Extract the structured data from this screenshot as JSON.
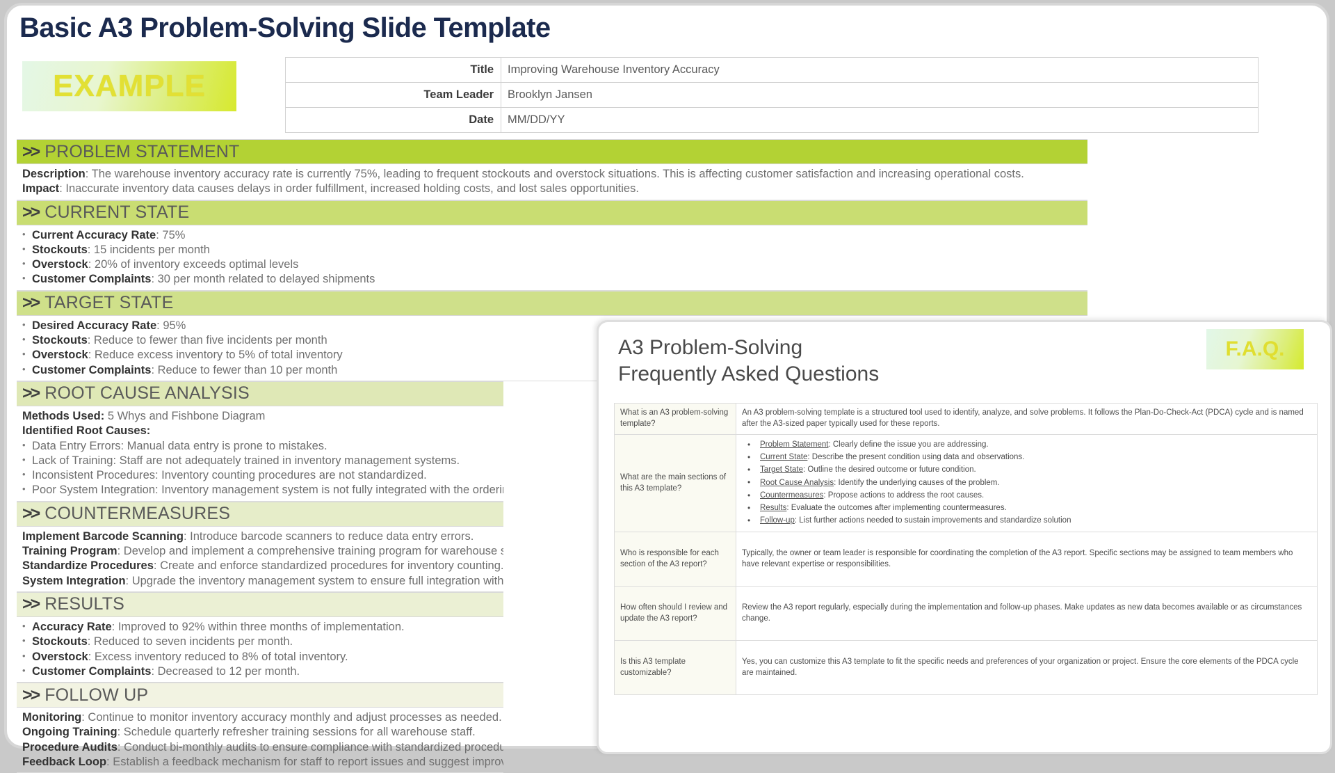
{
  "page_title": "Basic A3 Problem-Solving Slide Template",
  "example_badge": "EXAMPLE",
  "colors": {
    "title": "#1b2a4e",
    "bar_1": "#b3d234",
    "bar_2": "#c9dd72",
    "bar_3": "#cfe08a",
    "bar_4": "#dfe8b6",
    "bar_5": "#e6edc9",
    "bar_6": "#ebf0d4",
    "bar_7": "#f2f3e2",
    "badge_text": "#e2e034",
    "faq_question_bg": "#fafaf2"
  },
  "meta": {
    "rows": [
      {
        "label": "Title",
        "value": "Improving Warehouse Inventory Accuracy"
      },
      {
        "label": "Team Leader",
        "value": "Brooklyn Jansen"
      },
      {
        "label": "Date",
        "value": "MM/DD/YY"
      }
    ]
  },
  "chevron": ">>",
  "sections": {
    "problem": {
      "heading": "PROBLEM STATEMENT",
      "description_label": "Description",
      "description_text": ": The warehouse inventory accuracy rate is currently 75%, leading to frequent stockouts and overstock situations. This is affecting customer satisfaction and increasing operational costs.",
      "impact_label": "Impact",
      "impact_text": ": Inaccurate inventory data causes delays in order fulfillment, increased holding costs, and lost sales opportunities."
    },
    "current_state": {
      "heading": "CURRENT STATE",
      "items": [
        {
          "label": "Current Accuracy Rate",
          "text": ": 75%"
        },
        {
          "label": "Stockouts",
          "text": ": 15 incidents per month"
        },
        {
          "label": "Overstock",
          "text": ": 20% of inventory exceeds optimal levels"
        },
        {
          "label": "Customer Complaints",
          "text": ": 30 per month related to delayed shipments"
        }
      ]
    },
    "target_state": {
      "heading": "TARGET STATE",
      "items": [
        {
          "label": "Desired Accuracy Rate",
          "text": ": 95%"
        },
        {
          "label": "Stockouts",
          "text": ": Reduce to fewer than five incidents per month"
        },
        {
          "label": "Overstock",
          "text": ": Reduce excess inventory to 5% of total inventory"
        },
        {
          "label": "Customer Complaints",
          "text": ": Reduce to fewer than 10 per month"
        }
      ]
    },
    "root_cause": {
      "heading": "ROOT CAUSE ANALYSIS",
      "methods_label": "Methods Used:",
      "methods_value": "  5 Whys and Fishbone Diagram",
      "identified_label": "Identified Root Causes:",
      "items": [
        "Data Entry Errors: Manual data entry is prone to mistakes.",
        "Lack of Training: Staff are not adequately trained in inventory management systems.",
        "Inconsistent Procedures: Inventory counting procedures are not standardized.",
        "Poor System Integration: Inventory management system is not fully integrated with the ordering system."
      ]
    },
    "countermeasures": {
      "heading": "COUNTERMEASURES",
      "items": [
        {
          "label": "Implement Barcode Scanning",
          "text": ": Introduce barcode scanners to reduce data entry errors."
        },
        {
          "label": "Training Program",
          "text": ": Develop and implement a comprehensive training program for warehouse staff on inventory management."
        },
        {
          "label": "Standardize Procedures",
          "text": ": Create and enforce standardized procedures for inventory counting."
        },
        {
          "label": "System Integration",
          "text": ": Upgrade the inventory management system to ensure full integration with the ordering system."
        }
      ]
    },
    "results": {
      "heading": "RESULTS",
      "items": [
        {
          "label": "Accuracy Rate",
          "text": ": Improved to 92% within three months of implementation."
        },
        {
          "label": "Stockouts",
          "text": ": Reduced to seven incidents per month."
        },
        {
          "label": "Overstock",
          "text": ": Excess inventory reduced to 8% of total inventory."
        },
        {
          "label": "Customer Complaints",
          "text": ": Decreased to 12 per month."
        }
      ]
    },
    "follow_up": {
      "heading": "FOLLOW UP",
      "items": [
        {
          "label": "Monitoring",
          "text": ": Continue to monitor inventory accuracy monthly and adjust processes as needed."
        },
        {
          "label": "Ongoing Training",
          "text": ": Schedule quarterly refresher training sessions for all warehouse staff."
        },
        {
          "label": "Procedure Audits",
          "text": ": Conduct bi-monthly audits to ensure compliance with standardized procedures."
        },
        {
          "label": "Feedback Loop",
          "text": ": Establish a feedback mechanism for staff to report issues and suggest improvements."
        }
      ]
    }
  },
  "faq": {
    "title": "A3 Problem-Solving\nFrequently Asked Questions",
    "badge": "F.A.Q.",
    "rows": [
      {
        "question": "What is an A3 problem-solving template?",
        "answer": "An A3 problem-solving template is a structured tool used to identify, analyze, and solve problems. It follows the Plan-Do-Check-Act (PDCA) cycle and is named after the A3-sized paper typically used for these reports."
      },
      {
        "question": "What are the main sections of this A3 template?",
        "answer": "",
        "bullets": [
          {
            "term": "Problem Statement",
            "rest": ": Clearly define the issue you are addressing."
          },
          {
            "term": "Current State",
            "rest": ": Describe the present condition using data and observations."
          },
          {
            "term": "Target State",
            "rest": ": Outline the desired outcome or future condition."
          },
          {
            "term": "Root Cause Analysis",
            "rest": ": Identify the underlying causes of the problem."
          },
          {
            "term": "Countermeasures",
            "rest": ": Propose actions to address the root causes."
          },
          {
            "term": "Results",
            "rest": ": Evaluate the outcomes after implementing countermeasures."
          },
          {
            "term": "Follow-up",
            "rest": ": List further actions needed to sustain improvements and standardize solution"
          }
        ]
      },
      {
        "question": "Who is responsible for each section of the A3 report?",
        "answer": "Typically, the owner or team leader is responsible for coordinating the completion of the A3 report. Specific sections may be assigned to team members who have relevant expertise or responsibilities."
      },
      {
        "question": "How often should I review and update the A3 report?",
        "answer": "Review the A3 report regularly, especially during the implementation and follow-up phases. Make updates as new data becomes available or as circumstances change."
      },
      {
        "question": "Is this A3 template customizable?",
        "answer": "Yes, you can customize this A3 template to fit the specific needs and preferences of your organization or project. Ensure the core elements of the PDCA cycle are maintained."
      }
    ]
  }
}
